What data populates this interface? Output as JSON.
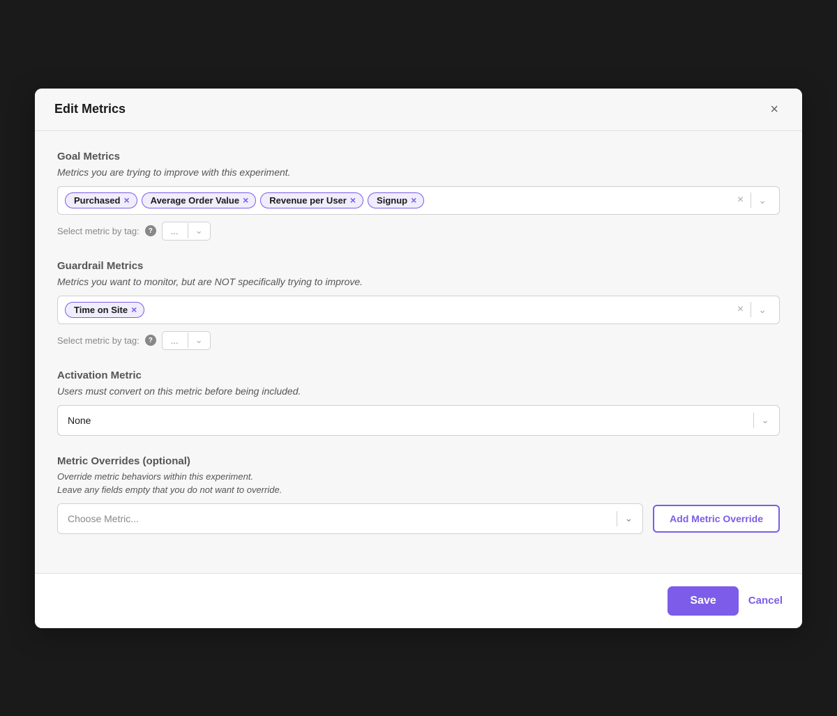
{
  "modal": {
    "title": "Edit Metrics",
    "close_label": "×"
  },
  "goal_metrics": {
    "section_title": "Goal Metrics",
    "section_desc": "Metrics you are trying to improve with this experiment.",
    "tags": [
      {
        "label": "Purchased"
      },
      {
        "label": "Average Order Value"
      },
      {
        "label": "Revenue per User"
      },
      {
        "label": "Signup"
      }
    ],
    "select_tag_label": "Select metric by tag:",
    "select_tag_value": "...",
    "help_text": "?"
  },
  "guardrail_metrics": {
    "section_title": "Guardrail Metrics",
    "section_desc": "Metrics you want to monitor, but are NOT specifically trying to improve.",
    "tags": [
      {
        "label": "Time on Site"
      }
    ],
    "select_tag_label": "Select metric by tag:",
    "select_tag_value": "...",
    "help_text": "?"
  },
  "activation_metric": {
    "section_title": "Activation Metric",
    "section_desc": "Users must convert on this metric before being included.",
    "value": "None"
  },
  "metric_overrides": {
    "section_title": "Metric Overrides (optional)",
    "desc_line1": "Override metric behaviors within this experiment.",
    "desc_line2": "Leave any fields empty that you do not want to override.",
    "choose_placeholder": "Choose Metric...",
    "add_button_label": "Add Metric Override"
  },
  "footer": {
    "save_label": "Save",
    "cancel_label": "Cancel"
  }
}
